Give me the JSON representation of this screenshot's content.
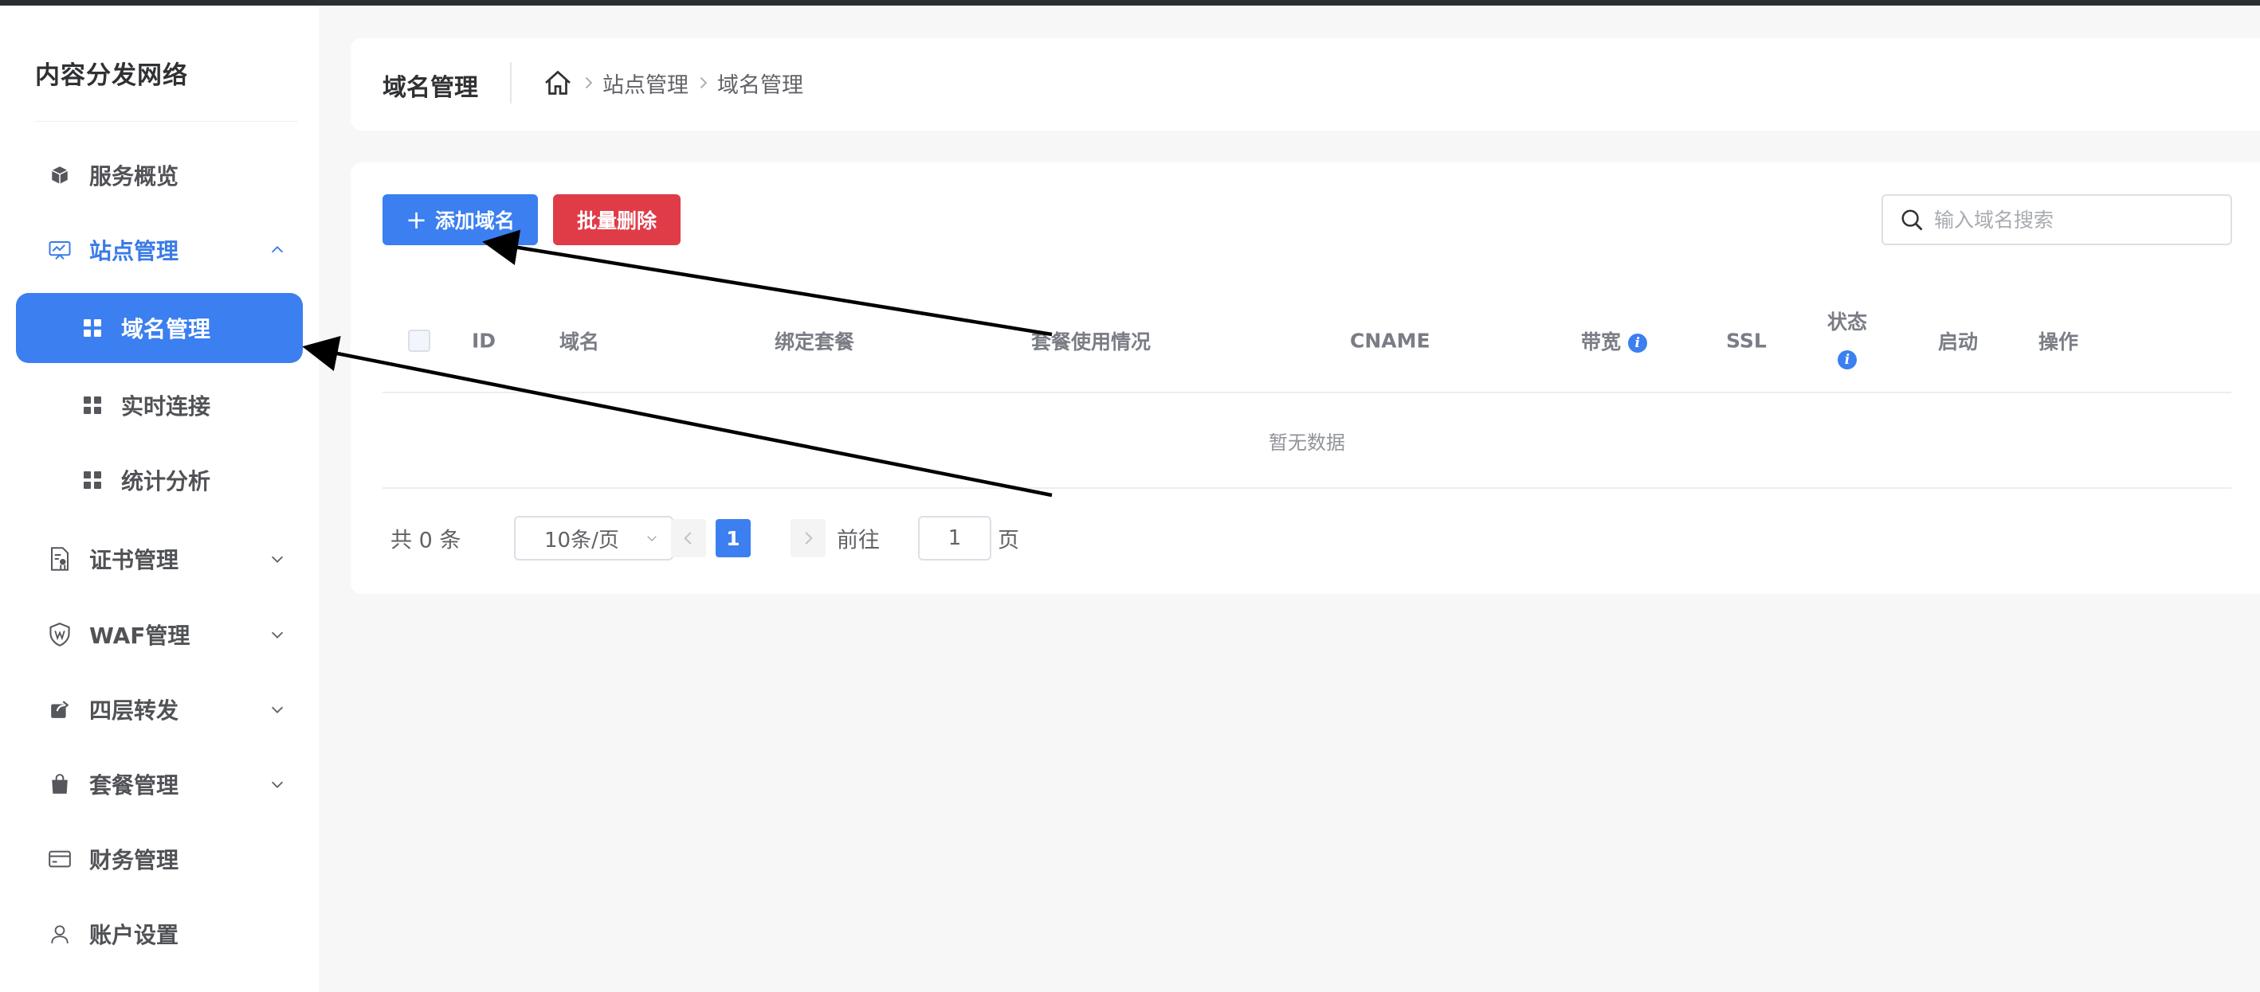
{
  "app": {
    "brand": "内容分发网络"
  },
  "sidebar": {
    "items": [
      {
        "label": "服务概览"
      },
      {
        "label": "站点管理"
      },
      {
        "label": "证书管理"
      },
      {
        "label": "WAF管理"
      },
      {
        "label": "四层转发"
      },
      {
        "label": "套餐管理"
      },
      {
        "label": "财务管理"
      },
      {
        "label": "账户设置"
      }
    ],
    "subitems": [
      {
        "label": "域名管理"
      },
      {
        "label": "实时连接"
      },
      {
        "label": "统计分析"
      }
    ]
  },
  "header": {
    "title": "域名管理",
    "breadcrumb": [
      "站点管理",
      "域名管理"
    ]
  },
  "toolbar": {
    "add_label": "添加域名",
    "add_icon": "+",
    "batch_delete_label": "批量删除",
    "search_placeholder": "输入域名搜索"
  },
  "table": {
    "columns": [
      "ID",
      "域名",
      "绑定套餐",
      "套餐使用情况",
      "CNAME",
      "带宽",
      "SSL",
      "状态",
      "启动",
      "操作"
    ],
    "info_glyph": "i",
    "empty_text": "暂无数据"
  },
  "pagination": {
    "total_text": "共 0 条",
    "page_size": "10条/页",
    "current_page": "1",
    "goto_prefix": "前往",
    "goto_value": "1",
    "goto_suffix": "页"
  },
  "colors": {
    "accent": "#3b7ff0",
    "danger": "#e03c48",
    "annotation_arrow": "#000000"
  }
}
